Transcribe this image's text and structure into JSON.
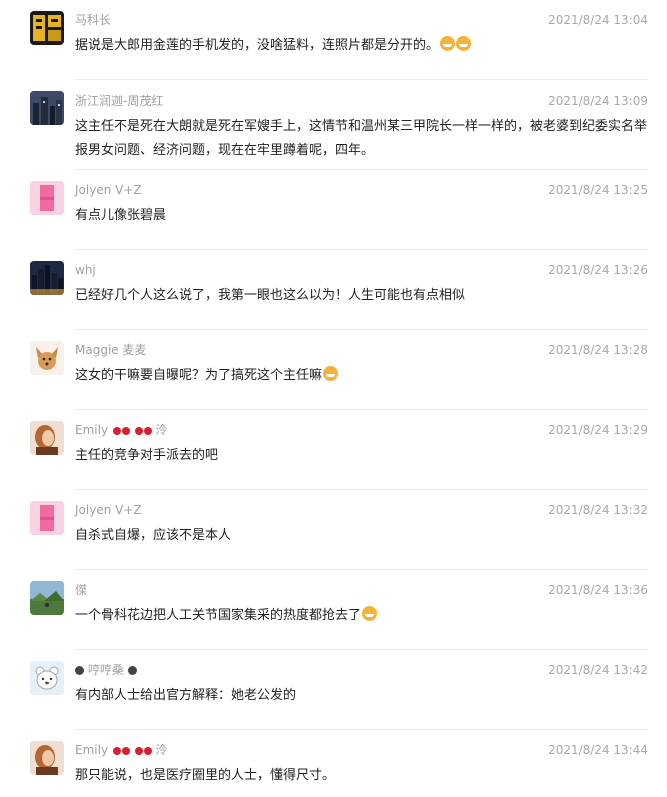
{
  "comments": [
    {
      "user": "马科长",
      "time": "2021/8/24 13:04",
      "text": "据说是大郎用金莲的手机发的，没啥猛料，连照片都是分开的。",
      "avatar": "black-gold-calligraphy-avatar",
      "emoji_count": 2
    },
    {
      "user": "浙江润迦-周茂红",
      "time": "2021/8/24 13:09",
      "text": "这主任不是死在大朗就是死在军嫂手上，这情节和温州某三甲院长一样一样的，被老婆到纪委实名举报男女问题、经济问题，现在在牢里蹲着呢，四年。",
      "avatar": "city-night-avatar"
    },
    {
      "user": "Jolyen V+Z",
      "time": "2021/8/24 13:25",
      "text": "有点儿像张碧晨",
      "avatar": "pink-square-avatar"
    },
    {
      "user": "whj",
      "time": "2021/8/24 13:26",
      "text": "已经好几个人这么说了，我第一眼也这么以为！人生可能也有点相似",
      "avatar": "city-skyline-avatar"
    },
    {
      "user": "Maggie 麦麦",
      "time": "2021/8/24 13:28",
      "text": "这女的干嘛要自曝呢？为了搞死这个主任嘛",
      "avatar": "dog-avatar",
      "emoji_count": 1
    },
    {
      "user": "Emily",
      "user_suffix": "泠",
      "time": "2021/8/24 13:29",
      "text": "主任的竞争对手派去的吧",
      "avatar": "woman-portrait-avatar",
      "cherries": 2
    },
    {
      "user": "Jolyen V+Z",
      "time": "2021/8/24 13:32",
      "text": "自杀式自爆，应该不是本人",
      "avatar": "pink-square-avatar"
    },
    {
      "user": "傑",
      "time": "2021/8/24 13:36",
      "text": "一个骨科花边把人工关节国家集采的热度都抢去了",
      "avatar": "landscape-avatar",
      "emoji_count": 1
    },
    {
      "user": "哼哼桑",
      "time": "2021/8/24 13:42",
      "text": "有内部人士给出官方解释：她老公发的",
      "avatar": "cartoon-bear-avatar",
      "paws": true
    },
    {
      "user": "Emily",
      "user_suffix": "泠",
      "time": "2021/8/24 13:44",
      "text": "那只能说，也是医疗圈里的人士，懂得尺寸。",
      "avatar": "woman-portrait-avatar",
      "cherries": 2
    }
  ],
  "colors": {
    "username": "#a0a0a0",
    "timestamp": "#a8a8a8",
    "body_text": "#222222",
    "divider": "#ececec",
    "pink_avatar": "#f06aa0"
  }
}
